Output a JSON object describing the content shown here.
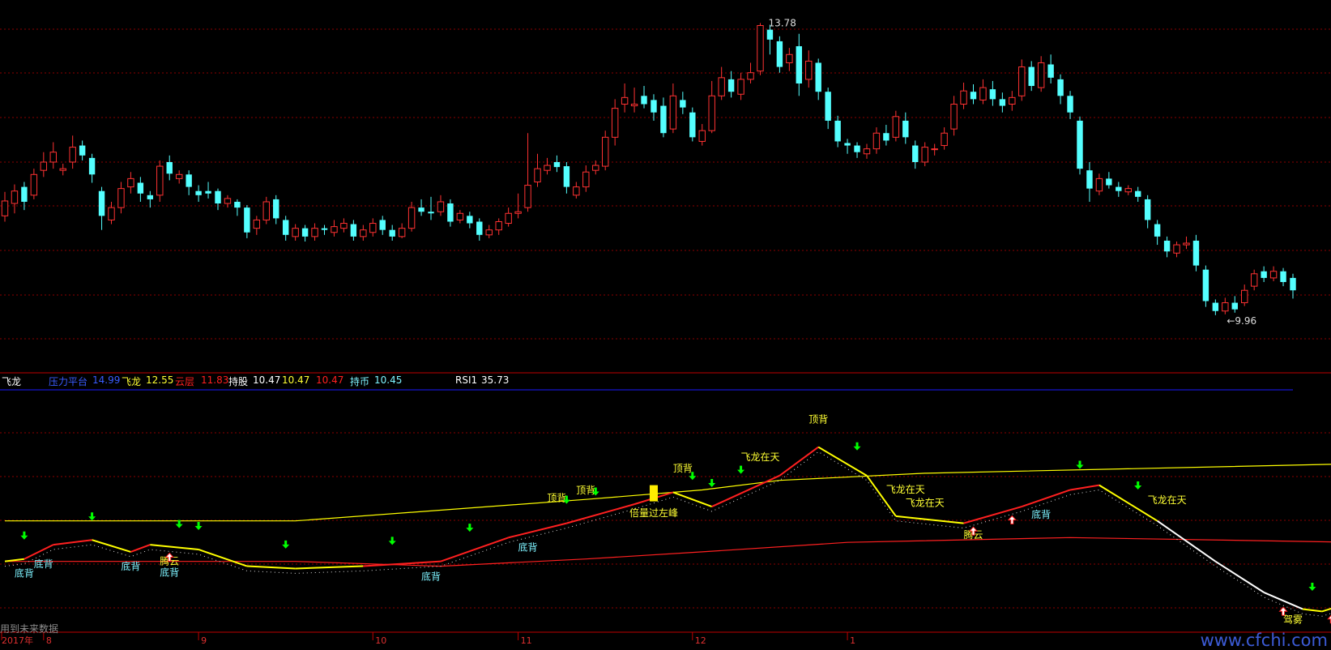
{
  "indicator": {
    "name": "飞龙",
    "pressure_label": "压力平台",
    "pressure_value": "14.99",
    "feilong_label": "飞龙",
    "feilong_value": "12.55",
    "yunceng_label": "云层",
    "yunceng_value": "11.83",
    "chigu_label": "持股",
    "chigu_value": "10.47",
    "extra_value_1": "10.47",
    "extra_value_2": "10.47",
    "chibi_label": "持币",
    "chibi_value": "10.45",
    "rsi_label": "RSI1",
    "rsi_value": "35.73"
  },
  "footnote": "用到未来数据",
  "watermark": "www.cfchi.com",
  "x_axis_labels": [
    "2017年",
    "8",
    "9",
    "10",
    "11",
    "12",
    "1"
  ],
  "price_annotations": {
    "high": "13.78",
    "low": "9.96"
  },
  "colors": {
    "up": "#ff3232",
    "down": "#54ffff",
    "yellow_line": "#ffff00",
    "red_line": "#ff2020",
    "white_line": "#ffffff",
    "grid": "#8b0000",
    "label_cyan": "#7ef3ff",
    "label_yellow": "#ffff33",
    "arrow_green": "#00ff00",
    "arrow_red": "#ff2020"
  },
  "chart_data": {
    "type": "candlestick",
    "price_axis_range": [
      9.7,
      14.0
    ],
    "candles": [
      [
        11.45,
        11.63,
        11.74,
        11.38
      ],
      [
        11.6,
        11.75,
        11.83,
        11.48
      ],
      [
        11.8,
        11.62,
        11.86,
        11.52
      ],
      [
        11.7,
        11.95,
        12.02,
        11.65
      ],
      [
        12.0,
        12.1,
        12.22,
        11.92
      ],
      [
        12.1,
        12.22,
        12.34,
        12.02
      ],
      [
        12.0,
        12.02,
        12.08,
        11.94
      ],
      [
        12.1,
        12.28,
        12.42,
        12.02
      ],
      [
        12.3,
        12.18,
        12.36,
        12.12
      ],
      [
        12.15,
        11.95,
        12.2,
        11.85
      ],
      [
        11.75,
        11.45,
        11.8,
        11.28
      ],
      [
        11.4,
        11.55,
        11.62,
        11.35
      ],
      [
        11.55,
        11.78,
        11.86,
        11.48
      ],
      [
        11.8,
        11.9,
        11.98,
        11.72
      ],
      [
        11.85,
        11.72,
        11.92,
        11.62
      ],
      [
        11.7,
        11.65,
        11.75,
        11.55
      ],
      [
        11.7,
        12.05,
        12.12,
        11.62
      ],
      [
        12.1,
        11.96,
        12.18,
        11.88
      ],
      [
        11.9,
        11.95,
        12.0,
        11.84
      ],
      [
        11.95,
        11.8,
        12.0,
        11.7
      ],
      [
        11.75,
        11.7,
        11.82,
        11.62
      ],
      [
        11.75,
        11.72,
        11.86,
        11.66
      ],
      [
        11.75,
        11.6,
        11.78,
        11.52
      ],
      [
        11.6,
        11.66,
        11.7,
        11.55
      ],
      [
        11.62,
        11.55,
        11.65,
        11.45
      ],
      [
        11.55,
        11.25,
        11.58,
        11.18
      ],
      [
        11.3,
        11.4,
        11.45,
        11.22
      ],
      [
        11.4,
        11.62,
        11.68,
        11.35
      ],
      [
        11.65,
        11.42,
        11.7,
        11.35
      ],
      [
        11.4,
        11.22,
        11.45,
        11.15
      ],
      [
        11.2,
        11.3,
        11.35,
        11.15
      ],
      [
        11.3,
        11.2,
        11.34,
        11.14
      ],
      [
        11.2,
        11.3,
        11.36,
        11.15
      ],
      [
        11.3,
        11.28,
        11.34,
        11.22
      ],
      [
        11.25,
        11.32,
        11.4,
        11.2
      ],
      [
        11.3,
        11.36,
        11.42,
        11.25
      ],
      [
        11.35,
        11.2,
        11.4,
        11.15
      ],
      [
        11.2,
        11.28,
        11.34,
        11.15
      ],
      [
        11.25,
        11.36,
        11.42,
        11.2
      ],
      [
        11.4,
        11.28,
        11.45,
        11.22
      ],
      [
        11.28,
        11.2,
        11.34,
        11.15
      ],
      [
        11.2,
        11.3,
        11.36,
        11.18
      ],
      [
        11.3,
        11.55,
        11.62,
        11.26
      ],
      [
        11.55,
        11.5,
        11.65,
        11.45
      ],
      [
        11.5,
        11.48,
        11.68,
        11.4
      ],
      [
        11.5,
        11.62,
        11.7,
        11.45
      ],
      [
        11.6,
        11.38,
        11.65,
        11.32
      ],
      [
        11.4,
        11.48,
        11.52,
        11.36
      ],
      [
        11.45,
        11.36,
        11.5,
        11.3
      ],
      [
        11.38,
        11.22,
        11.42,
        11.15
      ],
      [
        11.22,
        11.28,
        11.34,
        11.18
      ],
      [
        11.28,
        11.38,
        11.42,
        11.22
      ],
      [
        11.36,
        11.48,
        11.55,
        11.32
      ],
      [
        11.48,
        11.5,
        11.72,
        11.42
      ],
      [
        11.55,
        11.82,
        12.45,
        11.5
      ],
      [
        11.86,
        12.02,
        12.2,
        11.8
      ],
      [
        12.0,
        12.06,
        12.15,
        11.95
      ],
      [
        12.1,
        12.04,
        12.18,
        11.98
      ],
      [
        12.05,
        11.8,
        12.1,
        11.72
      ],
      [
        11.7,
        11.8,
        11.86,
        11.66
      ],
      [
        11.8,
        11.98,
        12.06,
        11.74
      ],
      [
        12.0,
        12.06,
        12.12,
        11.95
      ],
      [
        12.05,
        12.4,
        12.48,
        12.0
      ],
      [
        12.4,
        12.75,
        12.86,
        12.3
      ],
      [
        12.8,
        12.88,
        13.05,
        12.7
      ],
      [
        12.78,
        12.8,
        13.0,
        12.7
      ],
      [
        12.9,
        12.8,
        13.02,
        12.75
      ],
      [
        12.85,
        12.7,
        12.92,
        12.6
      ],
      [
        12.78,
        12.45,
        12.88,
        12.4
      ],
      [
        12.5,
        12.9,
        13.05,
        12.45
      ],
      [
        12.85,
        12.76,
        12.95,
        12.68
      ],
      [
        12.7,
        12.4,
        12.76,
        12.35
      ],
      [
        12.35,
        12.48,
        12.56,
        12.3
      ],
      [
        12.48,
        12.9,
        13.08,
        12.45
      ],
      [
        12.9,
        13.12,
        13.25,
        12.85
      ],
      [
        13.1,
        12.95,
        13.2,
        12.88
      ],
      [
        12.92,
        13.1,
        13.18,
        12.85
      ],
      [
        13.1,
        13.18,
        13.3,
        13.05
      ],
      [
        13.2,
        13.75,
        13.78,
        13.15
      ],
      [
        13.7,
        13.58,
        13.76,
        13.4
      ],
      [
        13.56,
        13.25,
        13.62,
        13.18
      ],
      [
        13.3,
        13.4,
        13.48,
        13.2
      ],
      [
        13.5,
        13.05,
        13.65,
        12.9
      ],
      [
        13.1,
        13.32,
        13.45,
        13.0
      ],
      [
        13.3,
        12.95,
        13.35,
        12.85
      ],
      [
        12.95,
        12.6,
        13.0,
        12.5
      ],
      [
        12.6,
        12.35,
        12.66,
        12.28
      ],
      [
        12.33,
        12.3,
        12.38,
        12.2
      ],
      [
        12.3,
        12.22,
        12.34,
        12.15
      ],
      [
        12.2,
        12.26,
        12.32,
        12.14
      ],
      [
        12.26,
        12.45,
        12.52,
        12.2
      ],
      [
        12.45,
        12.36,
        12.55,
        12.3
      ],
      [
        12.4,
        12.65,
        12.72,
        12.35
      ],
      [
        12.6,
        12.4,
        12.7,
        12.32
      ],
      [
        12.3,
        12.1,
        12.36,
        12.02
      ],
      [
        12.1,
        12.28,
        12.34,
        12.05
      ],
      [
        12.25,
        12.26,
        12.32,
        12.18
      ],
      [
        12.3,
        12.45,
        12.52,
        12.25
      ],
      [
        12.5,
        12.8,
        12.9,
        12.42
      ],
      [
        12.8,
        12.96,
        13.06,
        12.74
      ],
      [
        12.95,
        12.86,
        13.04,
        12.8
      ],
      [
        12.85,
        13.0,
        13.1,
        12.8
      ],
      [
        12.98,
        12.86,
        13.08,
        12.78
      ],
      [
        12.86,
        12.78,
        12.94,
        12.7
      ],
      [
        12.8,
        12.88,
        12.96,
        12.72
      ],
      [
        12.9,
        13.25,
        13.34,
        12.84
      ],
      [
        13.25,
        13.02,
        13.32,
        12.96
      ],
      [
        13.0,
        13.3,
        13.38,
        12.95
      ],
      [
        13.28,
        13.12,
        13.4,
        13.05
      ],
      [
        13.1,
        12.9,
        13.16,
        12.8
      ],
      [
        12.9,
        12.7,
        12.96,
        12.62
      ],
      [
        12.6,
        12.02,
        12.65,
        11.95
      ],
      [
        12.0,
        11.78,
        12.1,
        11.62
      ],
      [
        11.75,
        11.9,
        11.96,
        11.7
      ],
      [
        11.9,
        11.82,
        11.98,
        11.78
      ],
      [
        11.8,
        11.75,
        11.86,
        11.68
      ],
      [
        11.74,
        11.78,
        11.82,
        11.7
      ],
      [
        11.75,
        11.68,
        11.8,
        11.62
      ],
      [
        11.65,
        11.4,
        11.7,
        11.3
      ],
      [
        11.35,
        11.2,
        11.4,
        11.1
      ],
      [
        11.15,
        11.02,
        11.2,
        10.95
      ],
      [
        11.0,
        11.1,
        11.14,
        10.95
      ],
      [
        11.1,
        11.12,
        11.2,
        11.05
      ],
      [
        11.15,
        10.85,
        11.22,
        10.78
      ],
      [
        10.8,
        10.42,
        10.85,
        10.35
      ],
      [
        10.4,
        10.3,
        10.44,
        10.25
      ],
      [
        10.3,
        10.4,
        10.46,
        10.26
      ],
      [
        10.4,
        10.32,
        10.48,
        10.28
      ],
      [
        10.4,
        10.55,
        10.62,
        10.36
      ],
      [
        10.6,
        10.75,
        10.8,
        10.55
      ],
      [
        10.78,
        10.7,
        10.84,
        10.65
      ],
      [
        10.7,
        10.78,
        10.84,
        10.66
      ],
      [
        10.78,
        10.65,
        10.82,
        10.6
      ],
      [
        10.7,
        10.55,
        10.75,
        10.45
      ]
    ],
    "x_tick_indices": [
      0,
      4,
      20,
      38,
      53,
      71,
      87
    ],
    "indicator_lines": {
      "yellow_upper": [
        [
          0,
          0.55
        ],
        [
          30,
          0.55
        ],
        [
          60,
          0.46
        ],
        [
          72,
          0.42
        ],
        [
          80,
          0.38
        ],
        [
          95,
          0.35
        ],
        [
          140,
          0.31
        ]
      ],
      "red_lower": [
        [
          0,
          0.72
        ],
        [
          30,
          0.72
        ],
        [
          45,
          0.74
        ],
        [
          60,
          0.71
        ],
        [
          72,
          0.68
        ],
        [
          87,
          0.64
        ],
        [
          110,
          0.62
        ],
        [
          140,
          0.64
        ]
      ],
      "main_line": [
        [
          0,
          0.72
        ],
        [
          2,
          0.71
        ],
        [
          5,
          0.65
        ],
        [
          9,
          0.63
        ],
        [
          13,
          0.68
        ],
        [
          15,
          0.65
        ],
        [
          20,
          0.67
        ],
        [
          25,
          0.74
        ],
        [
          30,
          0.75
        ],
        [
          37,
          0.74
        ],
        [
          45,
          0.72
        ],
        [
          52,
          0.62
        ],
        [
          58,
          0.56
        ],
        [
          65,
          0.48
        ],
        [
          69,
          0.43
        ],
        [
          73,
          0.49
        ],
        [
          80,
          0.36
        ],
        [
          84,
          0.24
        ],
        [
          89,
          0.36
        ],
        [
          92,
          0.53
        ],
        [
          99,
          0.56
        ],
        [
          105,
          0.49
        ],
        [
          110,
          0.42
        ],
        [
          113,
          0.4
        ],
        [
          119,
          0.55
        ],
        [
          125,
          0.72
        ],
        [
          130,
          0.85
        ],
        [
          134,
          0.92
        ],
        [
          136,
          0.93
        ],
        [
          140,
          0.88
        ]
      ]
    }
  },
  "signals": [
    {
      "text": "底背",
      "idx": 2,
      "pos": "below",
      "color": "label_cyan"
    },
    {
      "text": "底背",
      "idx": 4,
      "pos": "below",
      "color": "label_cyan"
    },
    {
      "text": "底背",
      "idx": 13,
      "pos": "below",
      "color": "label_cyan"
    },
    {
      "text": "腾云",
      "idx": 17,
      "pos": "below",
      "color": "label_yellow"
    },
    {
      "text": "底背",
      "idx": 17,
      "pos": "below2",
      "color": "label_cyan"
    },
    {
      "text": "底背",
      "idx": 44,
      "pos": "below",
      "color": "label_cyan"
    },
    {
      "text": "底背",
      "idx": 54,
      "pos": "below",
      "color": "label_cyan"
    },
    {
      "text": "顶背",
      "idx": 57,
      "pos": "above",
      "color": "label_yellow"
    },
    {
      "text": "顶背",
      "idx": 60,
      "pos": "above",
      "color": "label_yellow"
    },
    {
      "text": "倍量过左峰",
      "idx": 67,
      "pos": "below",
      "color": "label_yellow"
    },
    {
      "text": "顶背",
      "idx": 70,
      "pos": "above",
      "color": "label_yellow"
    },
    {
      "text": "飞龙在天",
      "idx": 78,
      "pos": "above",
      "color": "label_yellow"
    },
    {
      "text": "顶背",
      "idx": 84,
      "pos": "above",
      "color": "label_yellow"
    },
    {
      "text": "飞龙在天",
      "idx": 93,
      "pos": "above",
      "color": "label_yellow"
    },
    {
      "text": "飞龙在天",
      "idx": 95,
      "pos": "above2",
      "color": "label_yellow"
    },
    {
      "text": "腾云",
      "idx": 100,
      "pos": "below",
      "color": "label_yellow"
    },
    {
      "text": "底背",
      "idx": 107,
      "pos": "below",
      "color": "label_cyan"
    },
    {
      "text": "飞龙在天",
      "idx": 120,
      "pos": "above",
      "color": "label_yellow"
    },
    {
      "text": "驾雾",
      "idx": 133,
      "pos": "below",
      "color": "label_yellow"
    }
  ],
  "green_arrows": [
    2,
    9,
    18,
    20,
    29,
    40,
    48,
    58,
    61,
    71,
    73,
    76,
    88,
    111,
    117,
    135,
    138
  ],
  "red_arrows": [
    17,
    100,
    104,
    132,
    137
  ]
}
